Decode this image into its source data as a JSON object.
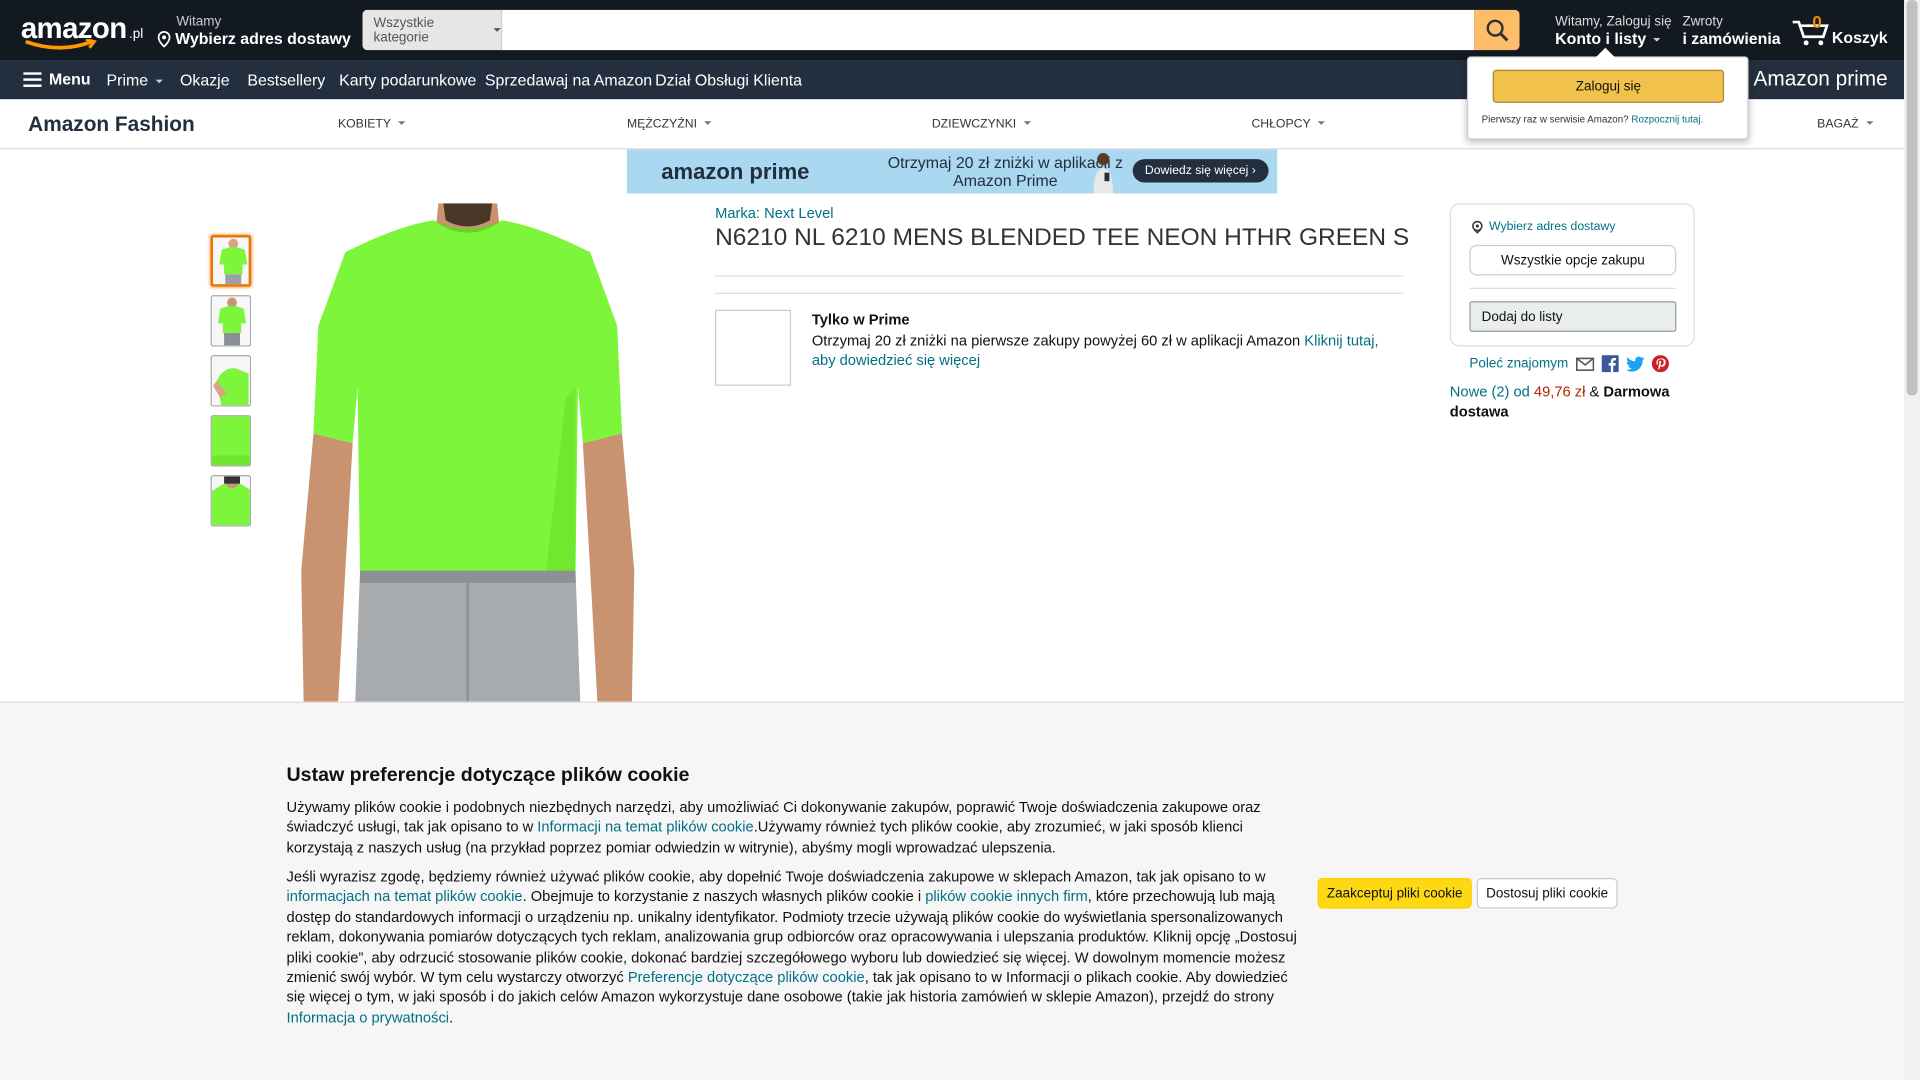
{
  "header": {
    "logo": "amazon",
    "logo_suffix": ".pl",
    "deliver_line1": "Witamy",
    "deliver_line2": "Wybierz adres dostawy",
    "search_category": "Wszystkie kategorie",
    "search_placeholder": "",
    "account_line1": "Witamy, Zaloguj się",
    "account_line2": "Konto i listy",
    "returns_line1": "Zwroty",
    "returns_line2": "i zamówienia",
    "cart_count": "0",
    "cart_label": "Koszyk"
  },
  "nav": {
    "menu": "Menu",
    "items": [
      "Prime",
      "Okazje",
      "Bestsellery",
      "Karty podarunkowe",
      "Sprzedawaj na Amazon",
      "Dział Obsługi Klienta"
    ],
    "prime_logo": "Amazon prime"
  },
  "fashion": {
    "brand": "Amazon Fashion",
    "categories": [
      "KOBIETY",
      "MĘŻCZYŹNI",
      "DZIEWCZYNKI",
      "CHŁOPCY",
      "BAGAŻ"
    ]
  },
  "signin_popup": {
    "button": "Zaloguj się",
    "new_text": "Pierwszy raz w serwisie Amazon?",
    "start_link": "Rozpocznij tutaj."
  },
  "banner": {
    "logo": "amazon prime",
    "text": "Otrzymaj 20 zł zniżki w aplikacji z Amazon Prime",
    "cta": "Dowiedz się więcej ›"
  },
  "product": {
    "brand": "Marka: Next Level",
    "title": "N6210 NL 6210 MENS BLENDED TEE NEON HTHR GREEN S",
    "prime_heading": "Tylko w Prime",
    "prime_text": "Otrzymaj 20 zł zniżki na pierwsze zakupy powyżej 60 zł w aplikacji Amazon ",
    "prime_link": "Kliknij tutaj, aby dowiedzieć się więcej"
  },
  "buybox": {
    "address": "Wybierz adres dostawy",
    "all_options": "Wszystkie opcje zakupu",
    "add_list": "Dodaj do listy",
    "share": "Poleć znajomym",
    "offers_prefix": "Nowe (2) od ",
    "offers_price": "49,76 zł",
    "offers_suffix": " & ",
    "offers_bold": "Darmowa dostawa"
  },
  "cookie": {
    "title": "Ustaw preferencje dotyczące plików cookie",
    "p1_a": "Używamy plików cookie i podobnych niezbędnych narzędzi, aby umożliwiać Ci dokonywanie zakupów, poprawić Twoje doświadczenia zakupowe oraz świadczyć usługi, tak jak opisano to w ",
    "p1_link": "Informacji na temat plików cookie",
    "p1_b": ".Używamy również tych plików cookie, aby zrozumieć, w jaki sposób klienci korzystają z naszych usług (na przykład poprzez pomiar odwiedzin w witrynie), abyśmy mogli wprowadzać ulepszenia.",
    "p2_a": "Jeśli wyrazisz zgodę, będziemy również używać plików cookie, aby dopełnić Twoje doświadczenia zakupowe w sklepach Amazon, tak jak opisano to w ",
    "p2_link1": "informacjach na temat plików cookie",
    "p2_b": ". Obejmuje to korzystanie z naszych własnych plików cookie i ",
    "p2_link2": "plików cookie innych firm",
    "p2_c": ", które przechowują lub mają dostęp do standardowych informacji o urządzeniu np. unikalny identyfikator. Podmioty trzecie używają plików cookie do wyświetlania spersonalizowanych reklam, dokonywania pomiarów dotyczących tych reklam, analizowania grup odbiorców oraz opracowywania i ulepszania produktów. Kliknij opcję „Dostosuj pliki cookie”, aby odrzucić stosowanie plików cookie, dokonać bardziej szczegółowego wyboru lub dowiedzieć się więcej. W dowolnym momencie możesz zmienić swój wybór. W tym celu wystarczy otworzyć ",
    "p2_link3": "Preferencje dotyczące plików cookie",
    "p2_d": ", tak jak opisano to w Informacji o plikach cookie. Aby dowiedzieć się więcej o tym, w jaki sposób i do jakich celów Amazon wykorzystuje dane osobowe (takie jak historia zamówień w sklepie Amazon), przejdź do strony ",
    "p2_link4": "Informacja o prywatności",
    "p2_e": ".",
    "accept": "Zaakceptuj pliki cookie",
    "customize": "Dostosuj pliki cookie"
  },
  "colors": {
    "nav_dark": "#131921",
    "nav_secondary": "#232f3e",
    "link": "#007185",
    "accent_orange": "#febd69",
    "button_yellow": "#ffd814",
    "shirt_green": "#7cf53b"
  }
}
